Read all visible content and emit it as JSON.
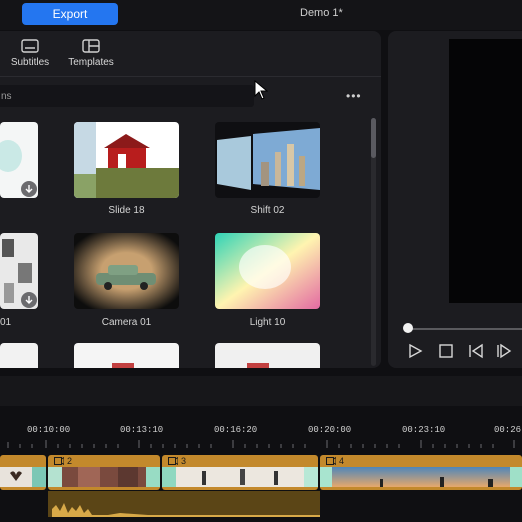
{
  "header": {
    "export_label": "Export",
    "title": "Demo 1*"
  },
  "tools": [
    {
      "label": "Subtitles",
      "icon": "subtitles-icon"
    },
    {
      "label": "Templates",
      "icon": "templates-icon"
    }
  ],
  "search": {
    "placeholder": "ns"
  },
  "media_grid": [
    {
      "label": "",
      "download_badge": true
    },
    {
      "label": "Slide 18"
    },
    {
      "label": "Shift 02"
    },
    {
      "label": "01",
      "download_badge": true
    },
    {
      "label": "Camera 01"
    },
    {
      "label": "Light 10"
    }
  ],
  "timeline": {
    "timecodes": [
      "00:10:00",
      "00:13:10",
      "00:16:20",
      "00:20:00",
      "00:23:10",
      "00:26"
    ],
    "clips": [
      {
        "number": "2"
      },
      {
        "number": "3"
      },
      {
        "number": "4"
      }
    ]
  },
  "colors": {
    "accent": "#2476f0",
    "clip": "#c3892c"
  }
}
